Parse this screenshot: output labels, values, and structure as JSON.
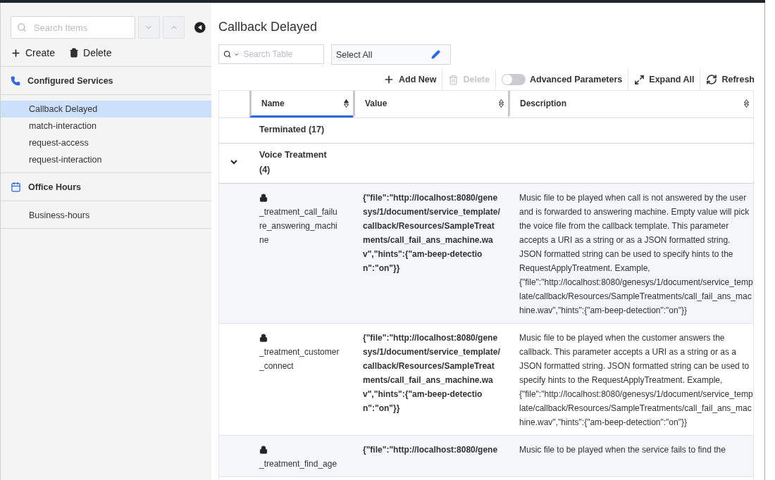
{
  "sidebar": {
    "search": {
      "placeholder": "Search Items"
    },
    "actions": [
      {
        "kind": "create",
        "label": "Create"
      },
      {
        "kind": "delete",
        "label": "Delete"
      }
    ],
    "sections": [
      {
        "kind": "phone",
        "title": "Configured Services",
        "items": [
          {
            "label": "Callback Delayed",
            "selected": true
          },
          {
            "label": "match-interaction",
            "selected": false
          },
          {
            "label": "request-access",
            "selected": false
          },
          {
            "label": "request-interaction",
            "selected": false
          }
        ]
      },
      {
        "kind": "calendar",
        "title": "Office Hours",
        "items": [
          {
            "label": "Business-hours",
            "selected": false
          }
        ]
      }
    ]
  },
  "main": {
    "title": "Callback Delayed",
    "search": {
      "placeholder": "Search Table"
    },
    "select": {
      "value": "Select All"
    },
    "toolbar": [
      {
        "kind": "add",
        "label": "Add New",
        "disabled": false
      },
      {
        "kind": "delete",
        "label": "Delete",
        "disabled": true
      },
      {
        "kind": "toggle",
        "label": "Advanced Parameters",
        "on": false
      },
      {
        "kind": "expand",
        "label": "Expand All",
        "disabled": false
      },
      {
        "kind": "refresh",
        "label": "Refresh",
        "disabled": false
      }
    ]
  },
  "table": {
    "columns": [
      {
        "label": "Name",
        "sorted": true
      },
      {
        "label": "Value",
        "sorted": false
      },
      {
        "label": "Description",
        "sorted": false
      }
    ],
    "groups": [
      {
        "label": "Terminated (17)",
        "expanded": false
      },
      {
        "label": "Voice Treatment (4)",
        "expanded": true,
        "rows": [
          {
            "name": "_treatment_call_failure_answering_machine",
            "value": "{\"file\":\"http://localhost:8080/genesys/1/document/service_template/callback/Resources/SampleTreatments/call_fail_ans_machine.wav\",\"hints\":{\"am-beep-detection\":\"on\"}}",
            "description": "Music file to be played when call is not answered by the user and is forwarded to answering machine. Empty value will pick the voice file from the callback template. This parameter accepts a URI as a string or as a JSON formatted string. JSON formatted string can be used to specify hints to the RequestApplyTreatment. Example, {\"file\":\"http://localhost:8080/genesys/1/document/service_template/callback/Resources/SampleTreatments/call_fail_ans_machine.wav\",\"hints\":{\"am-beep-detection\":\"on\"}}"
          },
          {
            "name": "_treatment_customer_connect",
            "value": "{\"file\":\"http://localhost:8080/genesys/1/document/service_template/callback/Resources/SampleTreatments/call_fail_ans_machine.wav\",\"hints\":{\"am-beep-detection\":\"on\"}}",
            "description": "Music file to be played when the customer answers the callback. This parameter accepts a URI as a string or as a JSON formatted string. JSON formatted string can be used to specify hints to the RequestApplyTreatment. Example, {\"file\":\"http://localhost:8080/genesys/1/document/service_template/callback/Resources/SampleTreatments/call_fail_ans_machine.wav\",\"hints\":{\"am-beep-detection\":\"on\"}}"
          },
          {
            "name": "_treatment_find_age",
            "value": "{\"file\":\"http://localhost:8080/gene",
            "description": "Music file to be played when the service fails to find the"
          }
        ]
      }
    ]
  }
}
